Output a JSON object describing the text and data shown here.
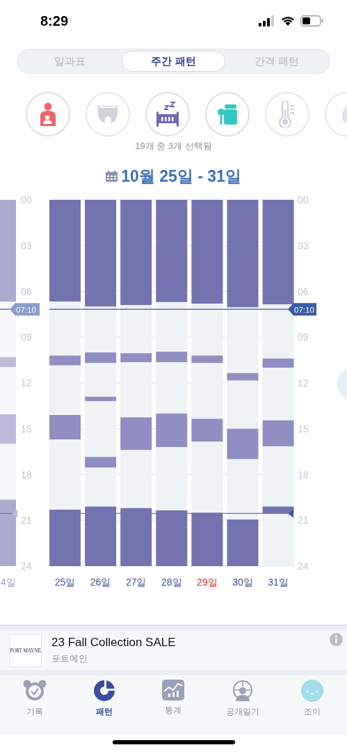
{
  "status_bar": {
    "time": "8:29"
  },
  "tabs": [
    {
      "label": "일과표",
      "selected": false
    },
    {
      "label": "주간 패턴",
      "selected": true
    },
    {
      "label": "간격 패턴",
      "selected": false
    }
  ],
  "filters": [
    {
      "kind": "feeding",
      "selected": true,
      "color": "#f0646a"
    },
    {
      "kind": "diaper",
      "selected": false
    },
    {
      "kind": "sleep",
      "selected": true,
      "color": "#6e6bb0"
    },
    {
      "kind": "meal",
      "selected": true,
      "color": "#36c7c0"
    },
    {
      "kind": "temperature",
      "selected": false
    },
    {
      "kind": "other",
      "selected": false
    }
  ],
  "selection_caption": "19개 중 3개 선택됨",
  "date_range": "10월 25일 - 31일",
  "chart_data": {
    "type": "bar",
    "orientation": "vertical",
    "stacked": true,
    "grid": true,
    "categories": [
      "4일",
      "25일",
      "26일",
      "27일",
      "28일",
      "29일",
      "30일",
      "31일"
    ],
    "ylim": [
      24,
      0
    ],
    "yticks": [
      {
        "value": 0,
        "label": "00"
      },
      {
        "value": 3,
        "label": "03"
      },
      {
        "value": 6,
        "label": "06"
      },
      {
        "value": 9,
        "label": "09"
      },
      {
        "value": 12,
        "label": "12"
      },
      {
        "value": 15,
        "label": "15"
      },
      {
        "value": 18,
        "label": "18"
      },
      {
        "value": 21,
        "label": "21"
      },
      {
        "value": 24,
        "label": "24"
      }
    ],
    "series": [
      {
        "color": "#7373b0",
        "values": [
          6.67,
          6.67,
          7.0,
          6.9,
          6.7,
          6.8,
          7.05,
          6.85
        ]
      },
      {
        "color": "#f0f3f5",
        "values": [
          3.63,
          3.53,
          3.0,
          3.15,
          3.25,
          3.4,
          4.3,
          3.55
        ]
      },
      {
        "color": "#918ec2",
        "values": [
          0.65,
          0.65,
          0.7,
          0.6,
          0.7,
          0.5,
          0.5,
          0.6
        ]
      },
      {
        "color": "#f0f3f5",
        "values": [
          3.1,
          3.25,
          2.2,
          3.6,
          3.35,
          3.65,
          3.15,
          3.45
        ]
      },
      {
        "color": "#918ec2",
        "values": [
          0,
          0,
          0.3,
          0,
          0,
          0,
          0,
          0
        ]
      },
      {
        "color": "#f0f3f5",
        "values": [
          0,
          0,
          3.65,
          0,
          0,
          0,
          0,
          0
        ]
      },
      {
        "color": "#918ec2",
        "values": [
          1.95,
          1.6,
          0.7,
          2.15,
          2.2,
          1.5,
          2.0,
          1.7
        ]
      },
      {
        "color": "#f0f3f5",
        "values": [
          3.65,
          4.6,
          2.55,
          3.8,
          4.15,
          4.65,
          3.95,
          3.95
        ]
      },
      {
        "color": "#7373b0",
        "values": [
          4.35,
          3.7,
          3.9,
          3.8,
          3.65,
          3.5,
          3.05,
          0.45
        ]
      },
      {
        "color": "#f0f3f5",
        "values": [
          0,
          0,
          0,
          0,
          0,
          0,
          0,
          3.45
        ]
      }
    ],
    "ref_lines": [
      {
        "axis": "y",
        "value": 7.17,
        "label": "07:10"
      },
      {
        "axis": "y",
        "value": 20.55
      }
    ]
  },
  "previous_week_tag": "07:10",
  "day_labels": [
    {
      "color": "#9a9cc0"
    },
    {
      "color": "#3d4f9a"
    },
    {
      "color": "#3d4f9a"
    },
    {
      "color": "#3d4f9a"
    },
    {
      "color": "#3d4f9a"
    },
    {
      "color": "#e4252c"
    },
    {
      "color": "#3d4f9a"
    },
    {
      "color": "#3d4f9a"
    }
  ],
  "ad": {
    "logo": "PORT MAYNE",
    "title": "23 Fall Collection SALE",
    "advertiser": "포트메인"
  },
  "nav": [
    {
      "kind": "record",
      "label": "기록",
      "selected": false
    },
    {
      "kind": "pattern",
      "label": "패턴",
      "selected": true
    },
    {
      "kind": "stats",
      "label": "통계",
      "selected": false
    },
    {
      "kind": "diary",
      "label": "공개일기",
      "selected": false
    },
    {
      "kind": "joy",
      "label": "조이",
      "selected": false
    }
  ]
}
